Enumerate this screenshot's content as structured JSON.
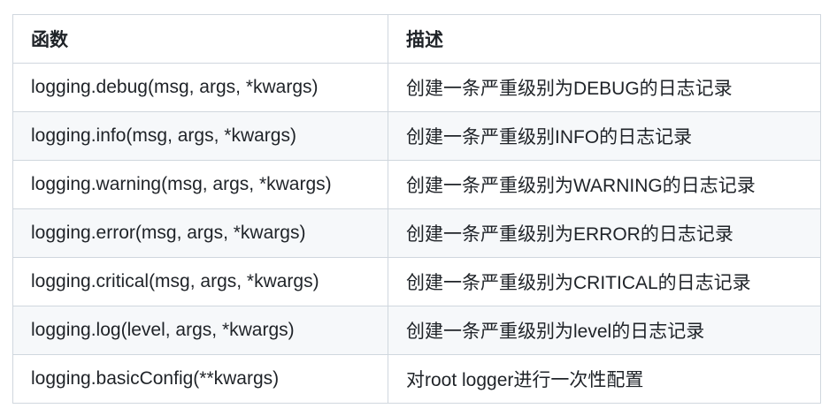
{
  "table": {
    "headers": [
      "函数",
      "描述"
    ],
    "rows": [
      [
        "logging.debug(msg, args, *kwargs)",
        "创建一条严重级别为DEBUG的日志记录"
      ],
      [
        "logging.info(msg, args, *kwargs)",
        "创建一条严重级别INFO的日志记录"
      ],
      [
        "logging.warning(msg, args, *kwargs)",
        "创建一条严重级别为WARNING的日志记录"
      ],
      [
        "logging.error(msg, args, *kwargs)",
        "创建一条严重级别为ERROR的日志记录"
      ],
      [
        "logging.critical(msg, args, *kwargs)",
        "创建一条严重级别为CRITICAL的日志记录"
      ],
      [
        "logging.log(level, args, *kwargs)",
        "创建一条严重级别为level的日志记录"
      ],
      [
        "logging.basicConfig(**kwargs)",
        "对root logger进行一次性配置"
      ]
    ]
  },
  "colors": {
    "border": "#d0d7de",
    "stripe": "#f6f8fa",
    "text": "#1f2328"
  }
}
